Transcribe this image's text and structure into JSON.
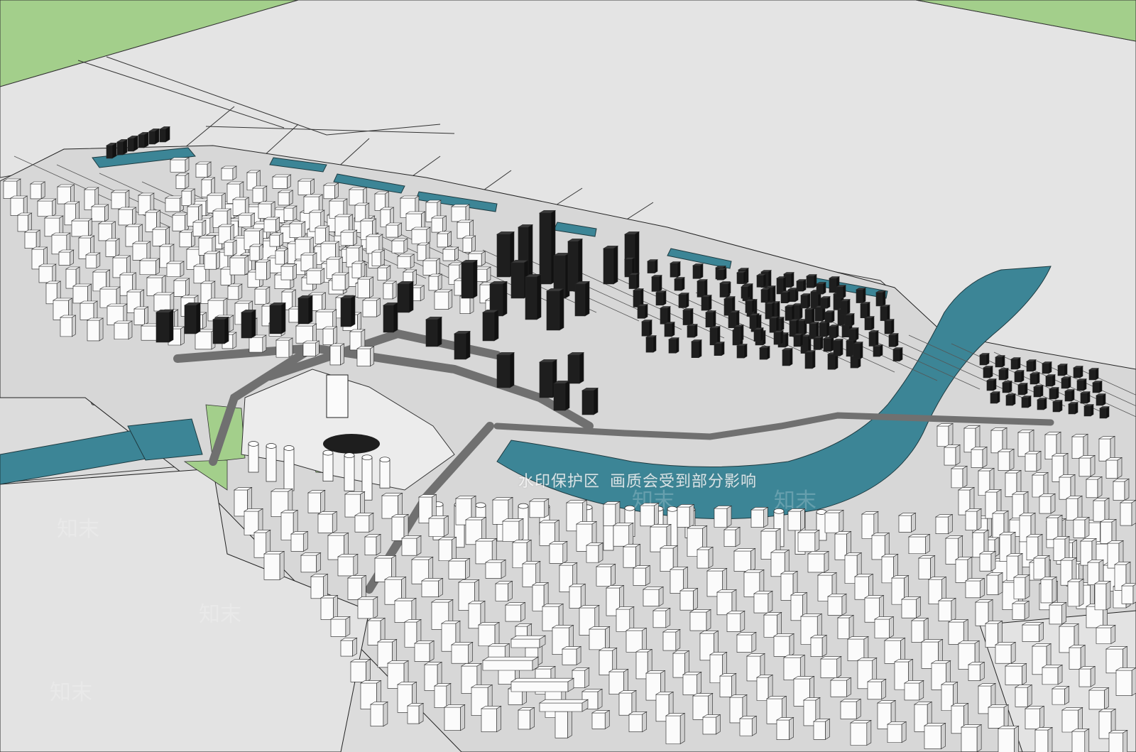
{
  "scene": {
    "colors": {
      "ground": "#dcdcdc",
      "far_ground": "#e6e6e6",
      "grass": "#a3cf8b",
      "water": "#3c8596",
      "road": "#707070",
      "building_white": "#fbfbfb",
      "building_dark": "#1e1e1e",
      "outline": "#222222"
    },
    "icons": [
      "building-block-icon",
      "tower-icon",
      "river-icon",
      "park-icon"
    ]
  },
  "watermark": {
    "prefix": "水印保护区",
    "text": "画质会受到部分影响",
    "brand": "知末"
  }
}
